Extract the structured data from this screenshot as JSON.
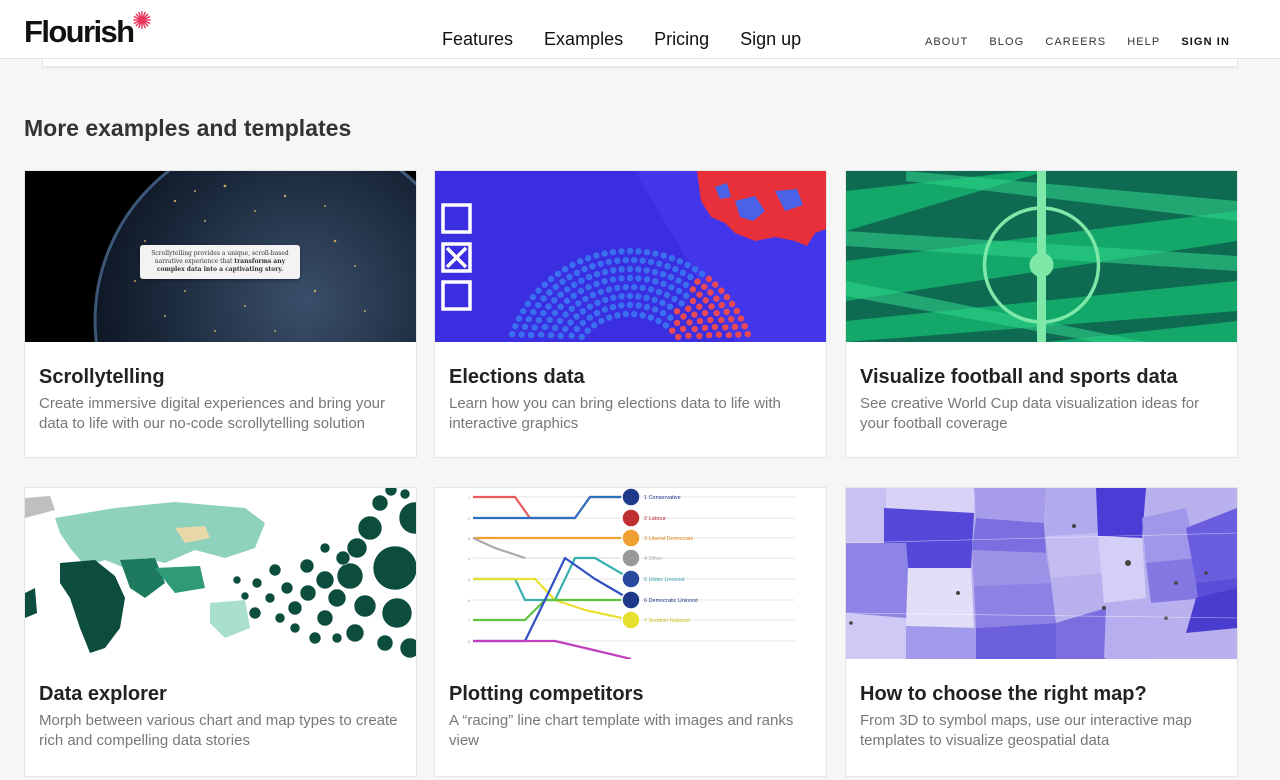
{
  "header": {
    "logo_text": "Flourish",
    "main_nav": [
      "Features",
      "Examples",
      "Pricing",
      "Sign up"
    ],
    "secondary_nav": [
      "ABOUT",
      "BLOG",
      "CAREERS",
      "HELP",
      "SIGN IN"
    ]
  },
  "section_title": "More examples and templates",
  "colors": {
    "brand_accent": "#e8335a",
    "election_blue": "#3a2ee0",
    "election_red": "#e8303a",
    "football_green": "#13a36a",
    "explorer_green": "#0d4d3d",
    "map_purple": "#7a6ee0"
  },
  "cards": [
    {
      "title": "Scrollytelling",
      "description": "Create immersive digital experiences and bring your data to life with our no-code scrollytelling solution",
      "thumb_caption_pre": "Scrollytelling provides a unique, scroll-based narrative experience that",
      "thumb_caption_bold": "transforms any complex data into a captivating story."
    },
    {
      "title": "Elections data",
      "description": "Learn how you can bring elections data to life with interactive graphics"
    },
    {
      "title": "Visualize football and sports data",
      "description": "See creative World Cup data visualization ideas for your football coverage"
    },
    {
      "title": "Data explorer",
      "description": "Morph between various chart and map types to create rich and compelling data stories"
    },
    {
      "title": "Plotting competitors",
      "description": "A “racing” line chart template with images and ranks view",
      "thumb_labels": [
        {
          "rank": "1",
          "name": "Conservative"
        },
        {
          "rank": "2",
          "name": "Labour"
        },
        {
          "rank": "3",
          "name": "Liberal Democrats"
        },
        {
          "rank": "4",
          "name": "Other"
        },
        {
          "rank": "5",
          "name": "Ulster Unionist"
        },
        {
          "rank": "6",
          "name": "Democratic Unionist"
        },
        {
          "rank": "7",
          "name": "Scottish National"
        }
      ]
    },
    {
      "title": "How to choose the right map?",
      "description": "From 3D to symbol maps, use our interactive map templates to visualize geospatial data"
    }
  ]
}
